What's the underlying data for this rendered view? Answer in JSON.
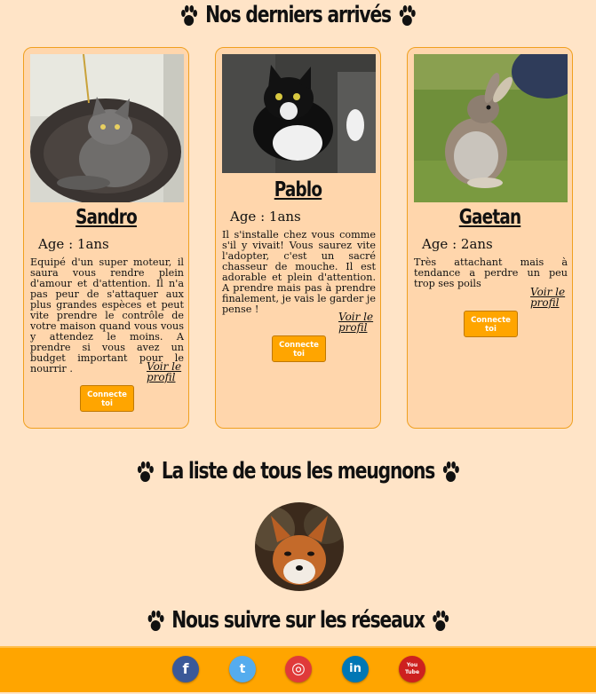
{
  "sections": {
    "new_title": "Nos derniers arrivés",
    "all_title": "La liste de tous les meugnons",
    "social_title": "Nous suivre sur les réseaux"
  },
  "cards": [
    {
      "name": "Sandro",
      "age": "Age : 1ans",
      "description": "Equipé d'un super moteur, il saura vous rendre plein d'amour et d'attention. Il n'a pas peur de s'attaquer aux plus grandes espèces et peut vite prendre le contrôle de votre maison quand vous vous y attendez le moins. A prendre si vous avez un budget important pour le nourrir .",
      "link": "Voir le profil",
      "button": "Connecte toi"
    },
    {
      "name": "Pablo",
      "age": "Age : 1ans",
      "description": "Il s'installe chez vous comme s'il y vivait! Vous saurez vite l'adopter, c'est un sacré chasseur de mouche. Il est adorable et plein d'attention. A prendre mais pas à prendre finalement, je vais le garder je pense !",
      "link": "Voir le profil",
      "button": "Connecte toi"
    },
    {
      "name": "Gaetan",
      "age": "Age : 2ans",
      "description": "Très attachant mais à tendance a perdre un peu trop ses poils",
      "link": "Voir le profil",
      "button": "Connecte toi"
    }
  ],
  "social": {
    "facebook": "f",
    "twitter": "t",
    "instagram": "◎",
    "linkedin": "in",
    "youtube": "You Tube"
  },
  "colors": {
    "background": "#ffe4c7",
    "card": "#ffd6ac",
    "accent": "#ffa500",
    "facebook": "#3b5998",
    "twitter": "#55acee",
    "instagram": "#e03a3a",
    "linkedin": "#0077b5",
    "youtube": "#cd201f"
  }
}
